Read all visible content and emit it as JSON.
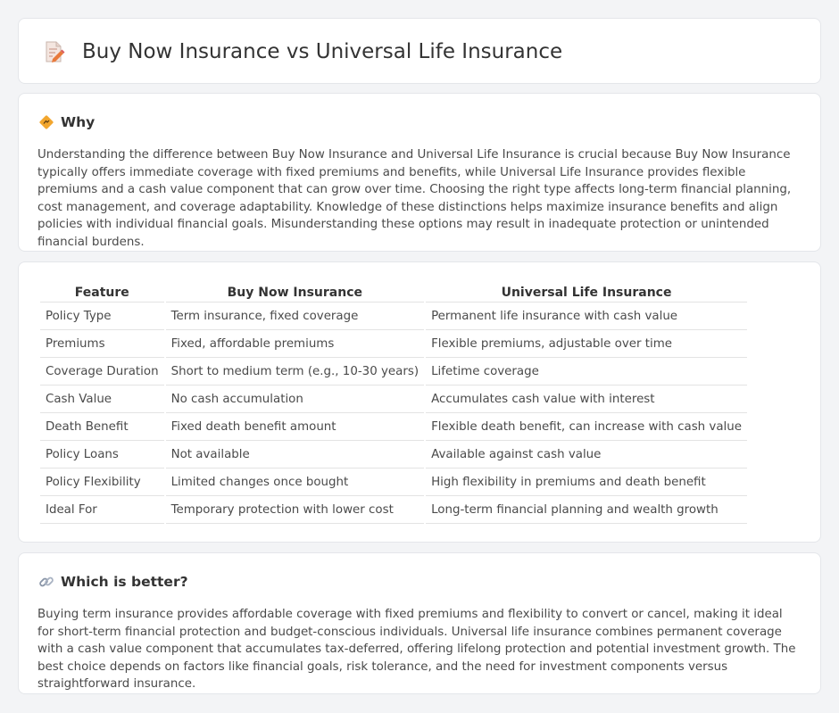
{
  "header": {
    "title": "Buy Now Insurance vs Universal Life Insurance",
    "icon": "document-pencil-icon"
  },
  "why": {
    "heading": "Why",
    "icon": "diamond-sign-icon",
    "body": "Understanding the difference between Buy Now Insurance and Universal Life Insurance is crucial because Buy Now Insurance typically offers immediate coverage with fixed premiums and benefits, while Universal Life Insurance provides flexible premiums and a cash value component that can grow over time. Choosing the right type affects long-term financial planning, cost management, and coverage adaptability. Knowledge of these distinctions helps maximize insurance benefits and align policies with individual financial goals. Misunderstanding these options may result in inadequate protection or unintended financial burdens."
  },
  "table": {
    "headers": [
      "Feature",
      "Buy Now Insurance",
      "Universal Life Insurance"
    ],
    "rows": [
      [
        "Policy Type",
        "Term insurance, fixed coverage",
        "Permanent life insurance with cash value"
      ],
      [
        "Premiums",
        "Fixed, affordable premiums",
        "Flexible premiums, adjustable over time"
      ],
      [
        "Coverage Duration",
        "Short to medium term (e.g., 10-30 years)",
        "Lifetime coverage"
      ],
      [
        "Cash Value",
        "No cash accumulation",
        "Accumulates cash value with interest"
      ],
      [
        "Death Benefit",
        "Fixed death benefit amount",
        "Flexible death benefit, can increase with cash value"
      ],
      [
        "Policy Loans",
        "Not available",
        "Available against cash value"
      ],
      [
        "Policy Flexibility",
        "Limited changes once bought",
        "High flexibility in premiums and death benefit"
      ],
      [
        "Ideal For",
        "Temporary protection with lower cost",
        "Long-term financial planning and wealth growth"
      ]
    ]
  },
  "better": {
    "heading": "Which is better?",
    "icon": "link-icon",
    "body": "Buying term insurance provides affordable coverage with fixed premiums and flexibility to convert or cancel, making it ideal for short-term financial protection and budget-conscious individuals. Universal life insurance combines permanent coverage with a cash value component that accumulates tax-deferred, offering lifelong protection and potential investment growth. The best choice depends on factors like financial goals, risk tolerance, and the need for investment components versus straightforward insurance."
  },
  "colors": {
    "background": "#f3f4f6",
    "card": "#ffffff",
    "text": "#444444",
    "accent_orange": "#f0a030"
  }
}
